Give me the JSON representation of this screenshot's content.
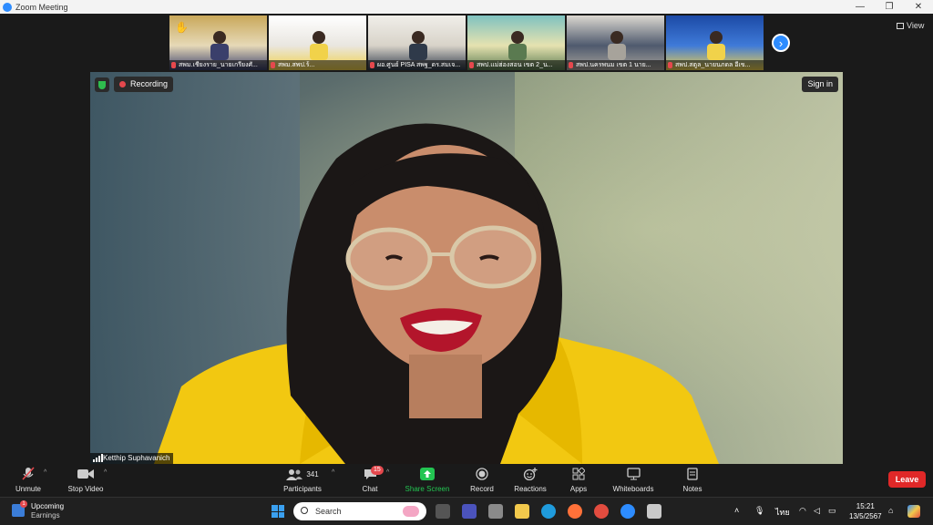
{
  "window": {
    "title": "Zoom Meeting",
    "controls": [
      "—",
      "❐",
      "✕"
    ]
  },
  "view_button": {
    "label": "View"
  },
  "gallery": [
    {
      "name": "สพม.เชียงราย_นายเกรียงศั...",
      "hand_raised": true,
      "colors": [
        "#c9a85a",
        "#e6d9b7",
        "#3a3f6b"
      ]
    },
    {
      "name": "สพม.สพป.ร้...",
      "hand_raised": false,
      "colors": [
        "#ffffff",
        "#e9e6e0",
        "#f1d24a"
      ]
    },
    {
      "name": "ผอ.ศูนย์ PISA สพฐ_ดร.สมเจ...",
      "hand_raised": false,
      "colors": [
        "#f0eee9",
        "#d8d3c9",
        "#2f3a4a"
      ]
    },
    {
      "name": "สพป.แม่ฮ่องสอน เขต 2_น...",
      "hand_raised": false,
      "colors": [
        "#7fc2c0",
        "#e6e2b0",
        "#5a7a50"
      ]
    },
    {
      "name": "สพป.นครพนม เขต 1 นาย...",
      "hand_raised": false,
      "colors": [
        "#dcd8d0",
        "#4f5a6e",
        "#a7a39b"
      ]
    },
    {
      "name": "สพป.สตูล_นายนภดล อีเข...",
      "hand_raised": false,
      "colors": [
        "#1c4aa6",
        "#3f7ad8",
        "#f1d24a"
      ]
    }
  ],
  "main": {
    "recording_label": "Recording",
    "sign_in_label": "Sign in",
    "speaker_name": "Ketthip Suphavanich"
  },
  "toolbar": {
    "unmute": "Unmute",
    "stop_video": "Stop Video",
    "participants": "Participants",
    "participants_count": "341",
    "chat": "Chat",
    "chat_badge": "15",
    "share_screen": "Share Screen",
    "record": "Record",
    "reactions": "Reactions",
    "apps": "Apps",
    "whiteboards": "Whiteboards",
    "notes": "Notes",
    "leave": "Leave"
  },
  "taskbar": {
    "weather_title": "Upcoming",
    "weather_sub": "Earnings",
    "weather_badge": "1",
    "search_placeholder": "Search",
    "language": "ไทย",
    "time": "15:21",
    "date": "13/5/2567"
  }
}
